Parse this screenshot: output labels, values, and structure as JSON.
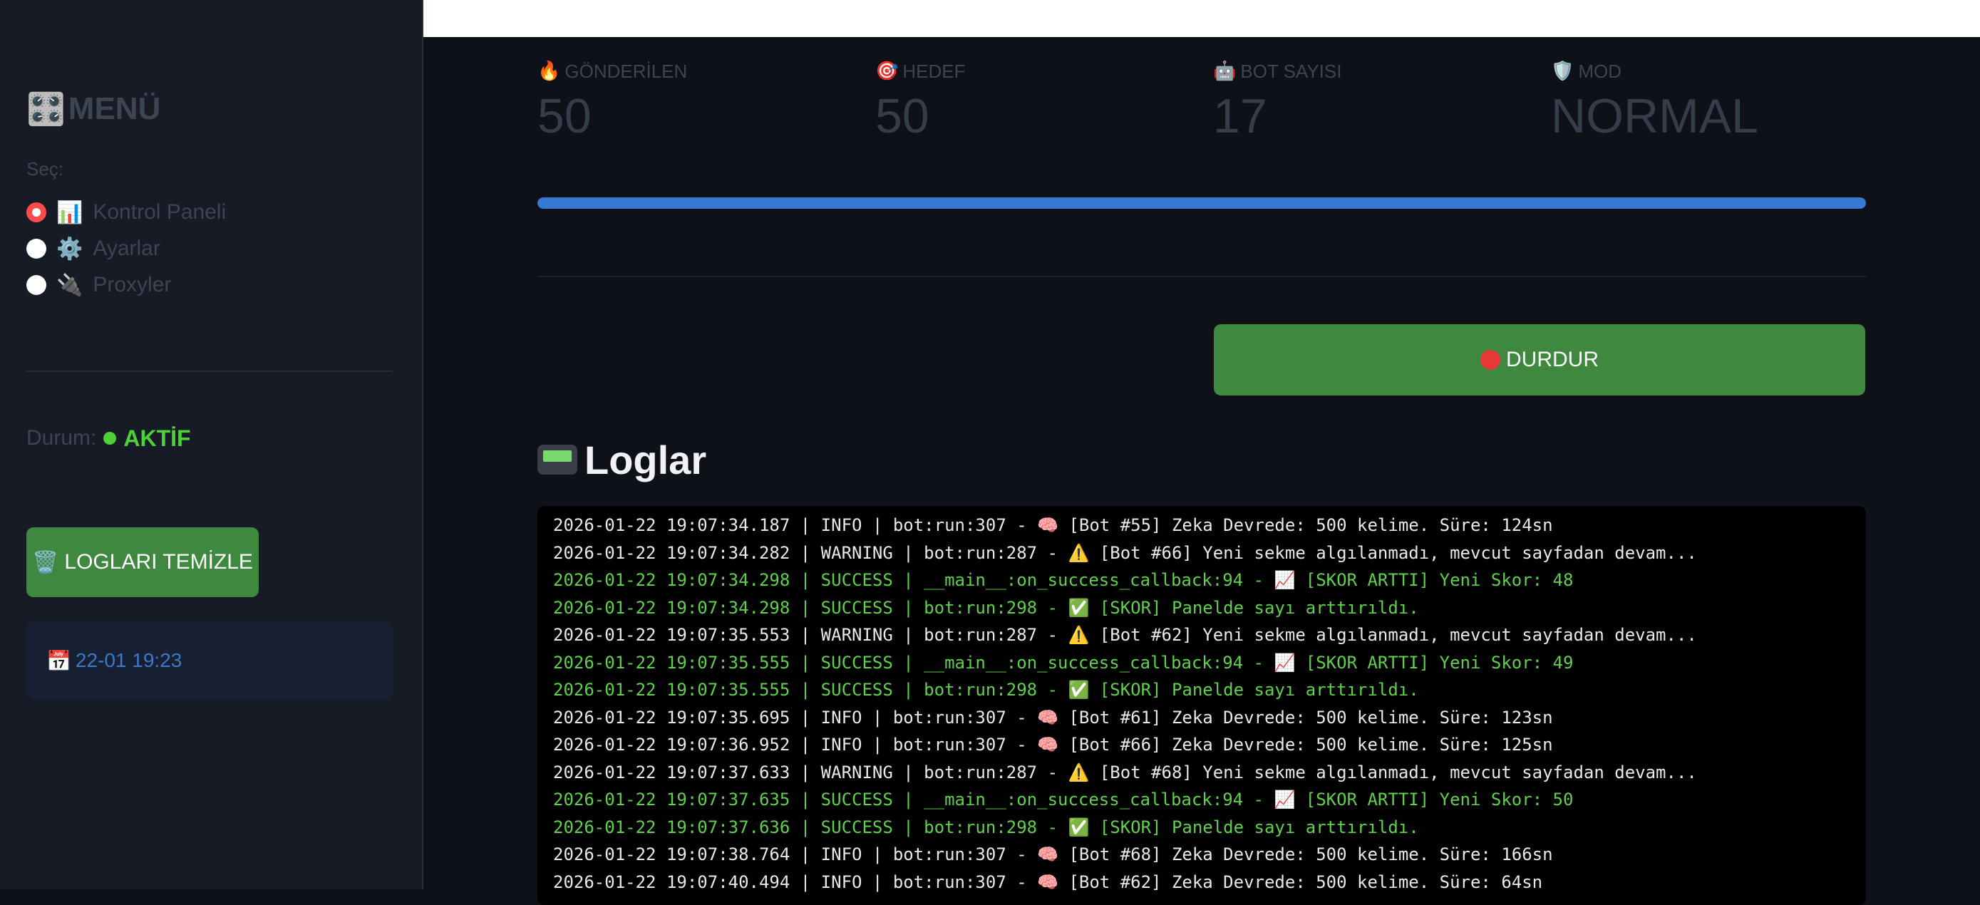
{
  "colors": {
    "success": "#4cd137",
    "log_default": "#e8e8e8",
    "log_success": "#5fd04a",
    "accent_button": "#3f8840",
    "progress": "#3979d6",
    "radio_selected": "#ff4b4b"
  },
  "sidebar": {
    "menu_icon": "🎛️",
    "menu_title": "MENÜ",
    "select_label": "Seç:",
    "options": [
      {
        "icon": "📊",
        "label": "Kontrol Paneli",
        "selected": true
      },
      {
        "icon": "⚙️",
        "label": "Ayarlar",
        "selected": false
      },
      {
        "icon": "🔌",
        "label": "Proxyler",
        "selected": false
      }
    ],
    "status_label": "Durum:",
    "status_value": "AKTİF",
    "clear_logs_icon": "🗑️",
    "clear_logs_label": "LOGLARI TEMİZLE",
    "date_icon": "📅",
    "date_text": "22-01 19:23"
  },
  "metrics": [
    {
      "icon": "🔥",
      "label": "GÖNDERİLEN",
      "value": "50"
    },
    {
      "icon": "🎯",
      "label": "HEDEF",
      "value": "50"
    },
    {
      "icon": "🤖",
      "label": "BOT SAYISI",
      "value": "17"
    },
    {
      "icon": "🛡️",
      "label": "MOD",
      "value": "NORMAL"
    }
  ],
  "progress": {
    "fraction": 1.0
  },
  "stop_button": {
    "label": "DURDUR"
  },
  "logs": {
    "title": "Loglar",
    "lines": [
      {
        "text": "2026-01-22 19:07:34.187 | INFO | bot:run:307 - 🧠 [Bot #55] Zeka Devrede: 500 kelime. Süre: 124sn",
        "level": "default"
      },
      {
        "text": "2026-01-22 19:07:34.282 | WARNING | bot:run:287 - ⚠️ [Bot #66] Yeni sekme algılanmadı, mevcut sayfadan devam...",
        "level": "default"
      },
      {
        "text": "2026-01-22 19:07:34.298 | SUCCESS | __main__:on_success_callback:94 - 📈 [SKOR ARTTI] Yeni Skor: 48",
        "level": "success"
      },
      {
        "text": "2026-01-22 19:07:34.298 | SUCCESS | bot:run:298 - ✅ [SKOR] Panelde sayı arttırıldı.",
        "level": "success"
      },
      {
        "text": "2026-01-22 19:07:35.553 | WARNING | bot:run:287 - ⚠️ [Bot #62] Yeni sekme algılanmadı, mevcut sayfadan devam...",
        "level": "default"
      },
      {
        "text": "2026-01-22 19:07:35.555 | SUCCESS | __main__:on_success_callback:94 - 📈 [SKOR ARTTI] Yeni Skor: 49",
        "level": "success"
      },
      {
        "text": "2026-01-22 19:07:35.555 | SUCCESS | bot:run:298 - ✅ [SKOR] Panelde sayı arttırıldı.",
        "level": "success"
      },
      {
        "text": "2026-01-22 19:07:35.695 | INFO | bot:run:307 - 🧠 [Bot #61] Zeka Devrede: 500 kelime. Süre: 123sn",
        "level": "default"
      },
      {
        "text": "2026-01-22 19:07:36.952 | INFO | bot:run:307 - 🧠 [Bot #66] Zeka Devrede: 500 kelime. Süre: 125sn",
        "level": "default"
      },
      {
        "text": "2026-01-22 19:07:37.633 | WARNING | bot:run:287 - ⚠️ [Bot #68] Yeni sekme algılanmadı, mevcut sayfadan devam...",
        "level": "default"
      },
      {
        "text": "2026-01-22 19:07:37.635 | SUCCESS | __main__:on_success_callback:94 - 📈 [SKOR ARTTI] Yeni Skor: 50",
        "level": "success"
      },
      {
        "text": "2026-01-22 19:07:37.636 | SUCCESS | bot:run:298 - ✅ [SKOR] Panelde sayı arttırıldı.",
        "level": "success"
      },
      {
        "text": "2026-01-22 19:07:38.764 | INFO | bot:run:307 - 🧠 [Bot #68] Zeka Devrede: 500 kelime. Süre: 166sn",
        "level": "default"
      },
      {
        "text": "2026-01-22 19:07:40.494 | INFO | bot:run:307 - 🧠 [Bot #62] Zeka Devrede: 500 kelime. Süre: 64sn",
        "level": "default"
      }
    ]
  }
}
